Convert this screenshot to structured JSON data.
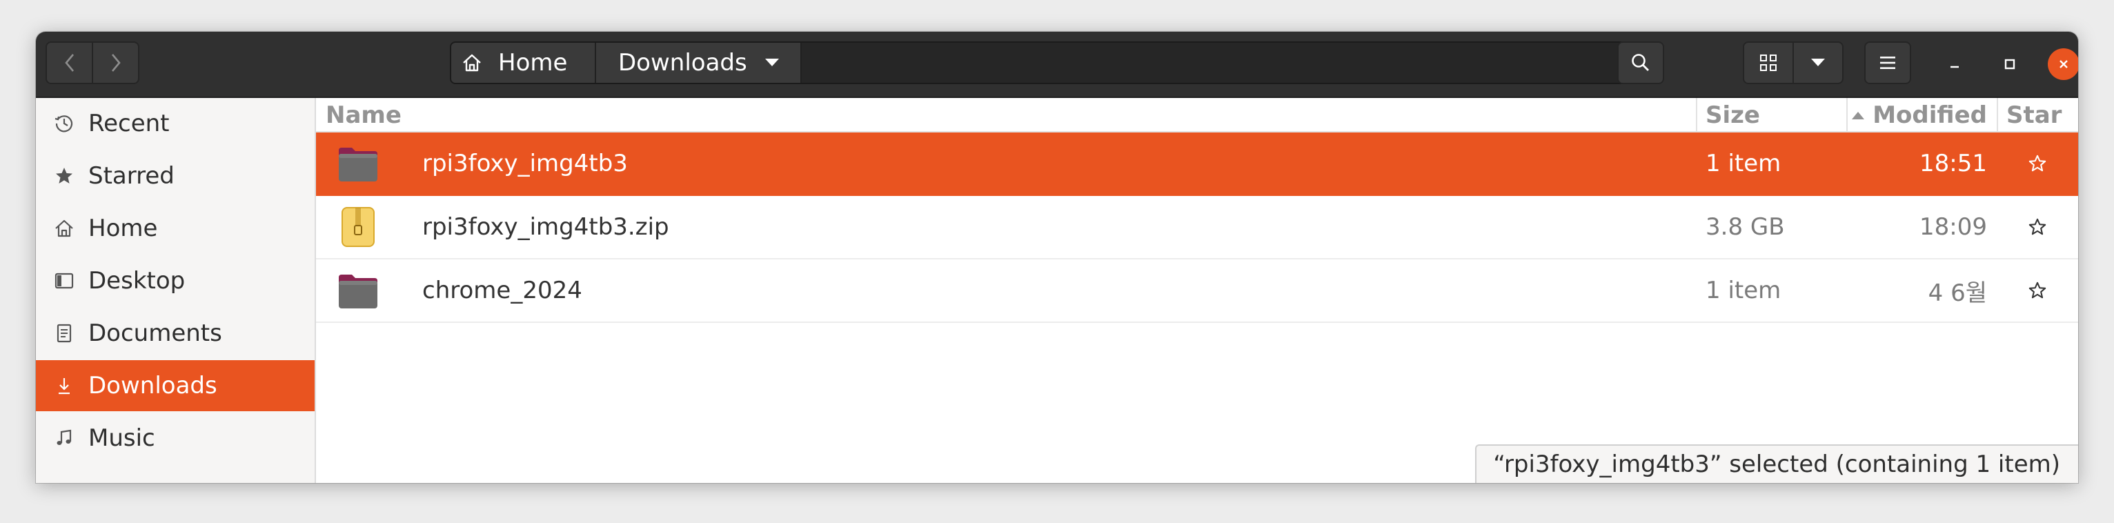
{
  "pathbar": {
    "home": "Home",
    "current": "Downloads"
  },
  "sidebar": {
    "items": [
      {
        "label": "Recent",
        "icon": "clock-icon"
      },
      {
        "label": "Starred",
        "icon": "star-icon"
      },
      {
        "label": "Home",
        "icon": "home-icon"
      },
      {
        "label": "Desktop",
        "icon": "desktop-icon"
      },
      {
        "label": "Documents",
        "icon": "document-icon"
      },
      {
        "label": "Downloads",
        "icon": "download-icon",
        "active": true
      },
      {
        "label": "Music",
        "icon": "music-icon"
      }
    ]
  },
  "columns": {
    "name": "Name",
    "size": "Size",
    "modified": "Modified",
    "star": "Star"
  },
  "files": [
    {
      "name": "rpi3foxy_img4tb3",
      "size": "1 item",
      "modified": "18:51",
      "icon": "folder-icon",
      "selected": true
    },
    {
      "name": "rpi3foxy_img4tb3.zip",
      "size": "3.8 GB",
      "modified": "18:09",
      "icon": "zip-archive-icon"
    },
    {
      "name": "chrome_2024",
      "size": "1 item",
      "modified": "4  6월",
      "icon": "folder-icon"
    }
  ],
  "status": "“rpi3foxy_img4tb3” selected (containing 1 item)",
  "colors": {
    "accent": "#e95420",
    "headerbar": "#303030",
    "sidebar": "#f6f5f4"
  }
}
